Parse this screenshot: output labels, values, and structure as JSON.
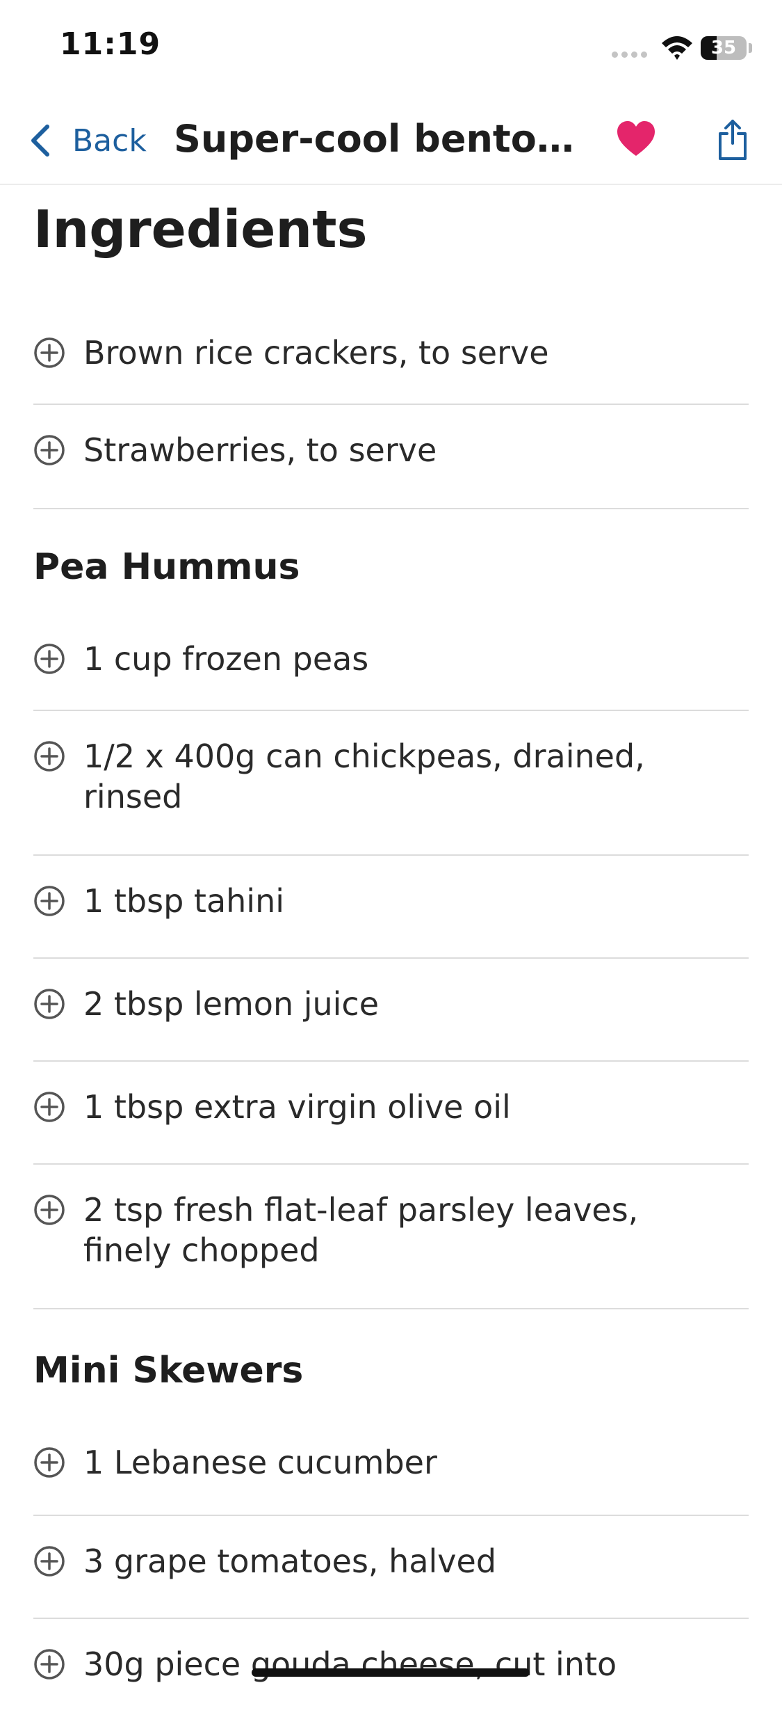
{
  "status": {
    "time": "11:19",
    "battery": "35",
    "battery_level": 0.35
  },
  "nav": {
    "back_label": "Back",
    "title": "Super-cool bento b..."
  },
  "page": {
    "heading": "Ingredients"
  },
  "groups": [
    {
      "title": "",
      "items": [
        "Brown rice crackers, to serve",
        "Strawberries, to serve"
      ]
    },
    {
      "title": "Pea Hummus",
      "items": [
        "1 cup frozen peas",
        "1/2 x 400g can chickpeas, drained, rinsed",
        "1 tbsp tahini",
        "2 tbsp lemon juice",
        "1 tbsp extra virgin olive oil",
        "2 tsp fresh flat-leaf parsley leaves, finely chopped"
      ]
    },
    {
      "title": "Mini Skewers",
      "items": [
        "1 Lebanese cucumber",
        "3 grape tomatoes, halved",
        "30g piece gouda cheese, cut into"
      ]
    }
  ],
  "colors": {
    "accent": "#1d5f9e",
    "favorite": "#e4256b",
    "divider": "#dcdcdc"
  },
  "icons": {
    "back": "chevron-left-icon",
    "favorite": "heart-icon",
    "share": "share-icon",
    "add": "plus-circle-icon"
  }
}
